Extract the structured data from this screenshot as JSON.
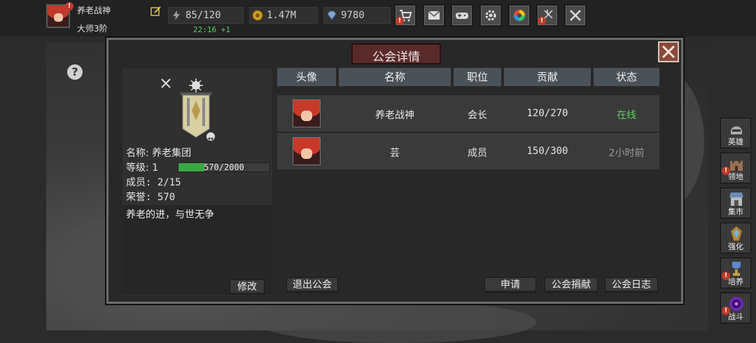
{
  "player": {
    "name": "养老战神",
    "rank": "大师3阶",
    "stamina": "85/120",
    "stamina_timer": "22:16 +1",
    "gold": "1.47M",
    "diamonds": "9780"
  },
  "toolbar": {
    "icons": [
      "shop-cart-icon",
      "mail-icon",
      "gamepad-icon",
      "gear-icon",
      "color-wheel-icon",
      "spark-icon",
      "crossed-swords-icon"
    ]
  },
  "dialog": {
    "title": "公会详情"
  },
  "guild": {
    "name_label": "名称: 养老集团",
    "level_label": "等级: 1",
    "xp_text": "570/2000",
    "xp_fraction": 0.285,
    "members_label": "成员: 2/15",
    "honor_label": "荣誉: 570",
    "motto": "养老的进，与世无争",
    "edit_button": "修改",
    "leave_button": "退出公会"
  },
  "table": {
    "headers": [
      "头像",
      "名称",
      "职位",
      "贡献",
      "状态"
    ],
    "rows": [
      {
        "name": "养老战神",
        "position": "会长",
        "contribution": "120/270",
        "status": "在线",
        "status_color": "#5ed15e"
      },
      {
        "name": "芸",
        "position": "成员",
        "contribution": "150/300",
        "status": "2小时前",
        "status_color": "#9a9a9a"
      }
    ]
  },
  "actions": {
    "apply": "申请",
    "donate": "公会捐献",
    "log": "公会日志"
  },
  "side_menu": [
    {
      "label": "英雄",
      "icon": "helmet-icon",
      "alert": false
    },
    {
      "label": "领地",
      "icon": "castle-icon",
      "alert": true
    },
    {
      "label": "集市",
      "icon": "market-stall-icon",
      "alert": false
    },
    {
      "label": "强化",
      "icon": "enhance-crystal-icon",
      "alert": false
    },
    {
      "label": "培养",
      "icon": "trophy-icon",
      "alert": true
    },
    {
      "label": "战斗",
      "icon": "vortex-icon",
      "alert": true
    }
  ],
  "colors": {
    "online": "#5ed15e",
    "xp_bar": "#39a845",
    "title_bg": "#5a2a2a"
  }
}
